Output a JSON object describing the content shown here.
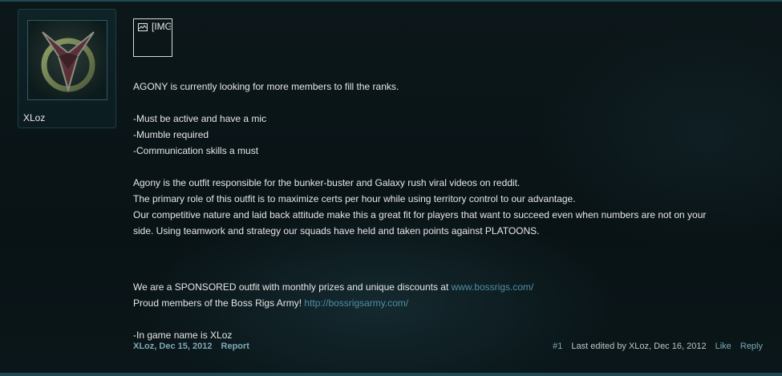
{
  "post": {
    "username": "XLoz",
    "image_placeholder": "[IMG]",
    "message": {
      "intro": "AGONY is currently looking for more members to fill the ranks.",
      "requirements": [
        "-Must be active and have a mic",
        "-Mumble required",
        "-Communication skills a must"
      ],
      "about": [
        "Agony is the outfit responsible for the bunker-buster and Galaxy rush viral videos on reddit.",
        "The primary role of this outfit is to maximize certs per hour while using territory control to our advantage.",
        "Our competitive nature and laid back attitude make this a great fit for players that want to succeed even when numbers are not on your",
        "side. Using teamwork and strategy our squads have held and taken points against PLATOONS."
      ],
      "sponsor_text": "We are a SPONSORED outfit with monthly prizes and unique discounts at ",
      "sponsor_link": "www.bossrigs.com/",
      "army_text": "Proud members of the Boss Rigs Army! ",
      "army_link": "http://bossrigsarmy.com/",
      "ign": "-In game name is XLoz"
    },
    "footer": {
      "author_date": "XLoz, Dec 15, 2012",
      "report": "Report",
      "post_number": "#1",
      "edited": "Last edited by XLoz, Dec 16, 2012",
      "like": "Like",
      "reply": "Reply"
    }
  },
  "colors": {
    "link": "#4d8fa3",
    "accent": "#1f4a54",
    "background": "#0a1518"
  }
}
